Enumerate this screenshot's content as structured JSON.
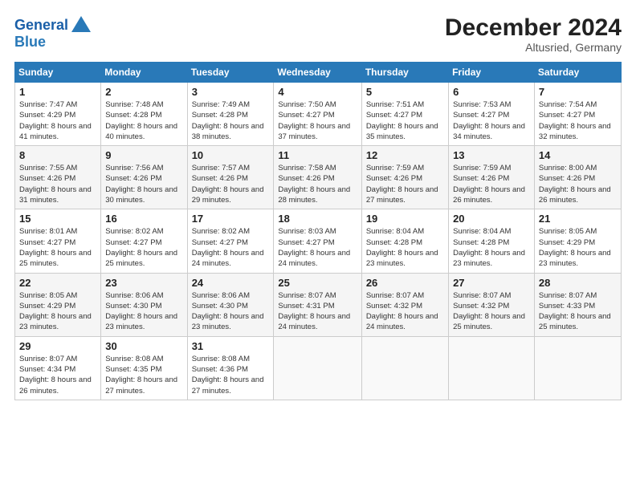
{
  "header": {
    "logo_line1": "General",
    "logo_line2": "Blue",
    "month": "December 2024",
    "location": "Altusried, Germany"
  },
  "weekdays": [
    "Sunday",
    "Monday",
    "Tuesday",
    "Wednesday",
    "Thursday",
    "Friday",
    "Saturday"
  ],
  "weeks": [
    [
      {
        "day": 1,
        "sunrise": "7:47 AM",
        "sunset": "4:29 PM",
        "daylight": "8 hours and 41 minutes."
      },
      {
        "day": 2,
        "sunrise": "7:48 AM",
        "sunset": "4:28 PM",
        "daylight": "8 hours and 40 minutes."
      },
      {
        "day": 3,
        "sunrise": "7:49 AM",
        "sunset": "4:28 PM",
        "daylight": "8 hours and 38 minutes."
      },
      {
        "day": 4,
        "sunrise": "7:50 AM",
        "sunset": "4:27 PM",
        "daylight": "8 hours and 37 minutes."
      },
      {
        "day": 5,
        "sunrise": "7:51 AM",
        "sunset": "4:27 PM",
        "daylight": "8 hours and 35 minutes."
      },
      {
        "day": 6,
        "sunrise": "7:53 AM",
        "sunset": "4:27 PM",
        "daylight": "8 hours and 34 minutes."
      },
      {
        "day": 7,
        "sunrise": "7:54 AM",
        "sunset": "4:27 PM",
        "daylight": "8 hours and 32 minutes."
      }
    ],
    [
      {
        "day": 8,
        "sunrise": "7:55 AM",
        "sunset": "4:26 PM",
        "daylight": "8 hours and 31 minutes."
      },
      {
        "day": 9,
        "sunrise": "7:56 AM",
        "sunset": "4:26 PM",
        "daylight": "8 hours and 30 minutes."
      },
      {
        "day": 10,
        "sunrise": "7:57 AM",
        "sunset": "4:26 PM",
        "daylight": "8 hours and 29 minutes."
      },
      {
        "day": 11,
        "sunrise": "7:58 AM",
        "sunset": "4:26 PM",
        "daylight": "8 hours and 28 minutes."
      },
      {
        "day": 12,
        "sunrise": "7:59 AM",
        "sunset": "4:26 PM",
        "daylight": "8 hours and 27 minutes."
      },
      {
        "day": 13,
        "sunrise": "7:59 AM",
        "sunset": "4:26 PM",
        "daylight": "8 hours and 26 minutes."
      },
      {
        "day": 14,
        "sunrise": "8:00 AM",
        "sunset": "4:26 PM",
        "daylight": "8 hours and 26 minutes."
      }
    ],
    [
      {
        "day": 15,
        "sunrise": "8:01 AM",
        "sunset": "4:27 PM",
        "daylight": "8 hours and 25 minutes."
      },
      {
        "day": 16,
        "sunrise": "8:02 AM",
        "sunset": "4:27 PM",
        "daylight": "8 hours and 25 minutes."
      },
      {
        "day": 17,
        "sunrise": "8:02 AM",
        "sunset": "4:27 PM",
        "daylight": "8 hours and 24 minutes."
      },
      {
        "day": 18,
        "sunrise": "8:03 AM",
        "sunset": "4:27 PM",
        "daylight": "8 hours and 24 minutes."
      },
      {
        "day": 19,
        "sunrise": "8:04 AM",
        "sunset": "4:28 PM",
        "daylight": "8 hours and 23 minutes."
      },
      {
        "day": 20,
        "sunrise": "8:04 AM",
        "sunset": "4:28 PM",
        "daylight": "8 hours and 23 minutes."
      },
      {
        "day": 21,
        "sunrise": "8:05 AM",
        "sunset": "4:29 PM",
        "daylight": "8 hours and 23 minutes."
      }
    ],
    [
      {
        "day": 22,
        "sunrise": "8:05 AM",
        "sunset": "4:29 PM",
        "daylight": "8 hours and 23 minutes."
      },
      {
        "day": 23,
        "sunrise": "8:06 AM",
        "sunset": "4:30 PM",
        "daylight": "8 hours and 23 minutes."
      },
      {
        "day": 24,
        "sunrise": "8:06 AM",
        "sunset": "4:30 PM",
        "daylight": "8 hours and 23 minutes."
      },
      {
        "day": 25,
        "sunrise": "8:07 AM",
        "sunset": "4:31 PM",
        "daylight": "8 hours and 24 minutes."
      },
      {
        "day": 26,
        "sunrise": "8:07 AM",
        "sunset": "4:32 PM",
        "daylight": "8 hours and 24 minutes."
      },
      {
        "day": 27,
        "sunrise": "8:07 AM",
        "sunset": "4:32 PM",
        "daylight": "8 hours and 25 minutes."
      },
      {
        "day": 28,
        "sunrise": "8:07 AM",
        "sunset": "4:33 PM",
        "daylight": "8 hours and 25 minutes."
      }
    ],
    [
      {
        "day": 29,
        "sunrise": "8:07 AM",
        "sunset": "4:34 PM",
        "daylight": "8 hours and 26 minutes."
      },
      {
        "day": 30,
        "sunrise": "8:08 AM",
        "sunset": "4:35 PM",
        "daylight": "8 hours and 27 minutes."
      },
      {
        "day": 31,
        "sunrise": "8:08 AM",
        "sunset": "4:36 PM",
        "daylight": "8 hours and 27 minutes."
      },
      null,
      null,
      null,
      null
    ]
  ]
}
